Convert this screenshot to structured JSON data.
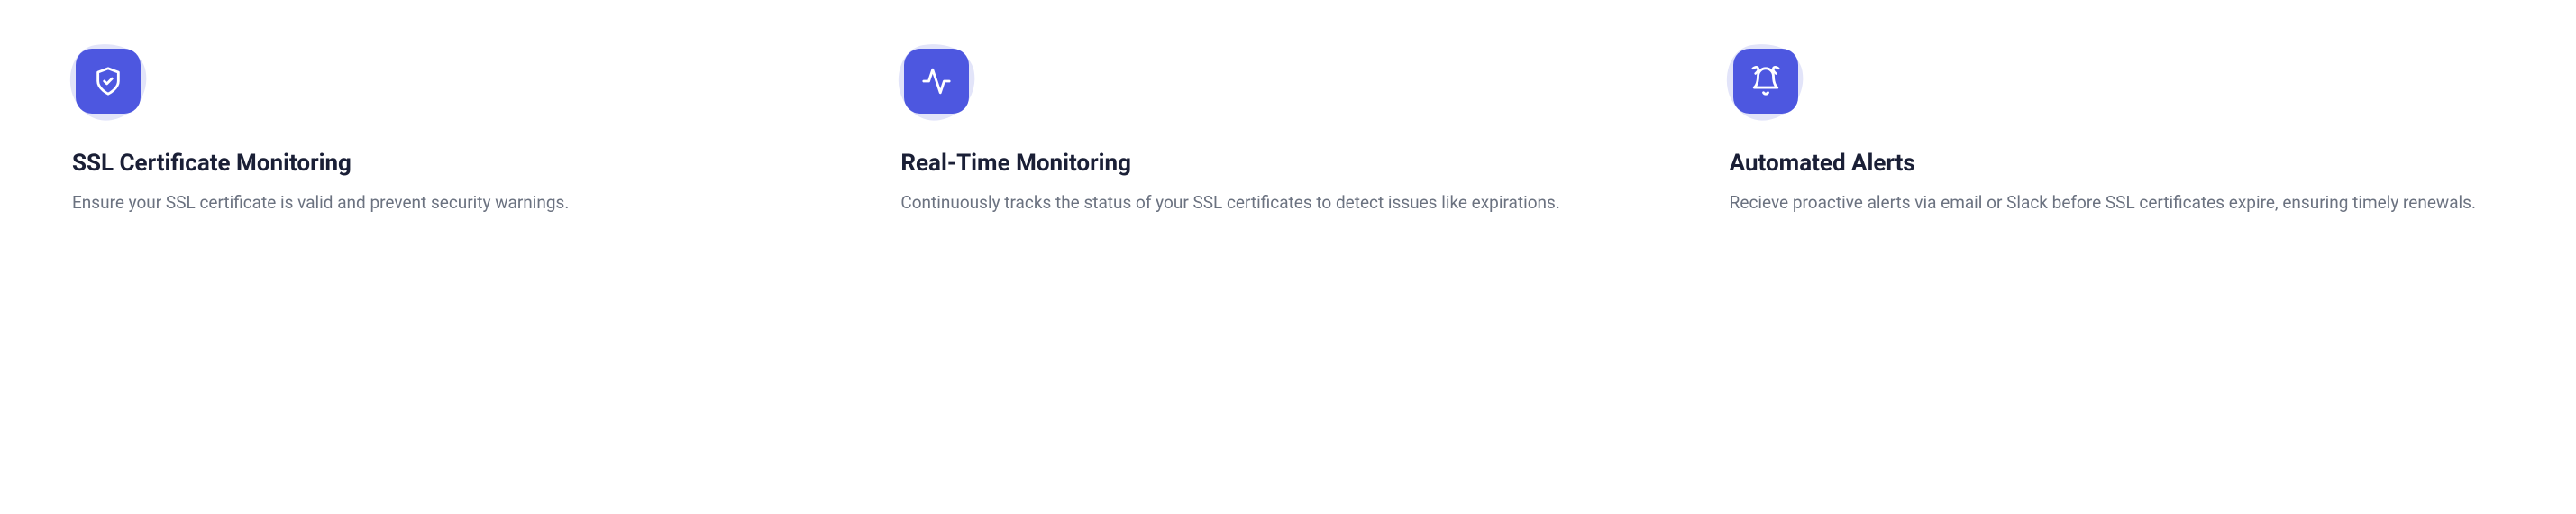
{
  "features": [
    {
      "icon": "shield-check-icon",
      "title": "SSL Certificate Monitoring",
      "description": "Ensure your SSL certificate is valid and prevent security warnings."
    },
    {
      "icon": "activity-icon",
      "title": "Real-Time Monitoring",
      "description": "Continuously tracks the status of your SSL certificates to detect issues like expirations."
    },
    {
      "icon": "bell-icon",
      "title": "Automated Alerts",
      "description": "Recieve proactive alerts via email or Slack before SSL certificates expire, ensuring timely renewals."
    }
  ],
  "colors": {
    "accent": "#4d57e0",
    "blob": "#e2e4f9",
    "heading": "#1a1f36",
    "body": "#6b7280"
  }
}
